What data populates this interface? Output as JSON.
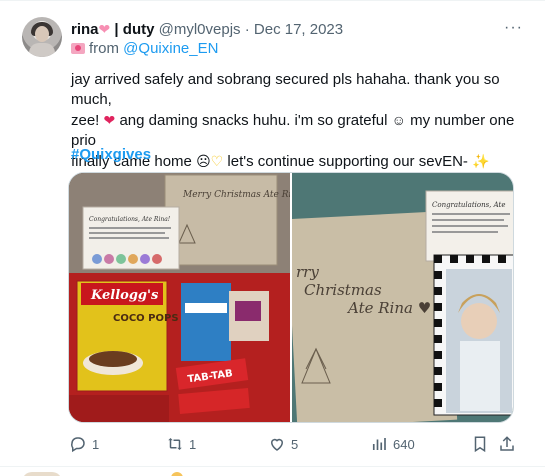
{
  "post": {
    "display_name": "rina",
    "name_suffix": "| duty",
    "handle": "@myl0vepjs",
    "separator": "·",
    "date": "Dec 17, 2023",
    "from_prefix": "from",
    "from_link": "@Quixine_EN",
    "text_line1": "jay arrived safely and sobrang secured pls hahaha. thank you so much,",
    "text_line2a": "zee!",
    "text_line2b": "ang daming snacks huhu. i'm so grateful",
    "text_line2c": "my number one prio",
    "text_line3a": "finally came home",
    "text_line3b": "let's continue supporting our sevEN-",
    "hashtag": "#Quixgives"
  },
  "media": {
    "left": {
      "card_title": "Congratulations, Ate Rina!",
      "note": "Merry Christmas Ate Rina ♥",
      "cereal_brand": "Kellogg's",
      "cereal_name": "COCO POPS",
      "snack_label": "TAB-TAB"
    },
    "right": {
      "note_line1": "rry",
      "note_line2": "Christmas",
      "note_line3": "Ate Rina ♥",
      "card_title": "Congratulations, Ate"
    }
  },
  "actions": {
    "reply_count": "1",
    "repost_count": "1",
    "like_count": "5",
    "views_count": "640"
  },
  "colors": {
    "link": "#1d9bf0",
    "muted": "#536471",
    "text": "#0f1419",
    "heart": "#e0245e"
  },
  "icons": [
    "heart-icon",
    "more-icon",
    "reply-icon",
    "repost-icon",
    "like-icon",
    "views-icon",
    "bookmark-icon",
    "share-icon"
  ]
}
